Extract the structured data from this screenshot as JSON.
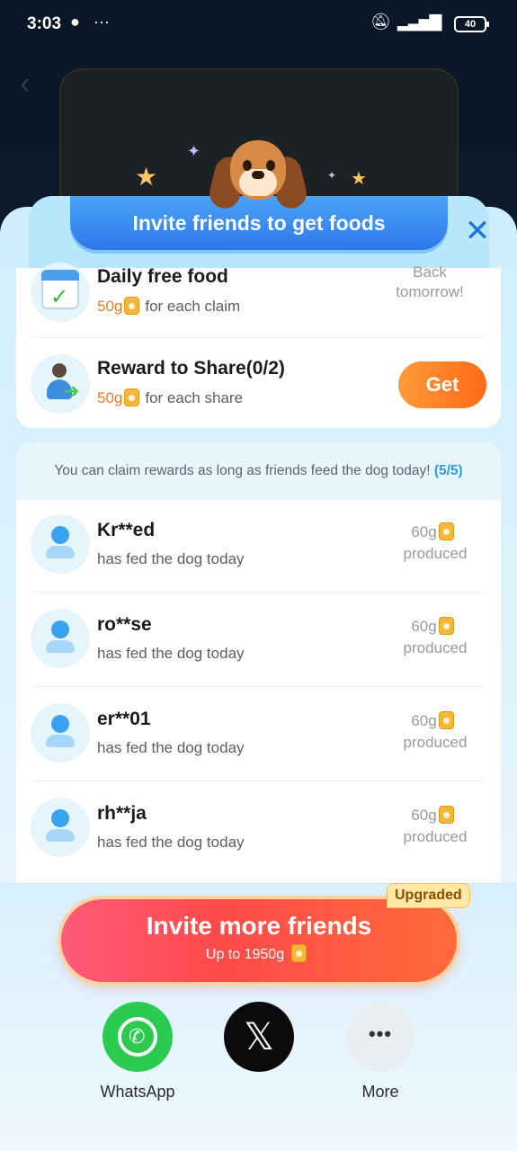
{
  "status_bar": {
    "time": "3:03",
    "battery": "40"
  },
  "sheet": {
    "title": "Invite friends to get foods",
    "close_symbol": "✕"
  },
  "tasks": [
    {
      "title": "Daily free food",
      "amount": "50g",
      "suffix": "for each claim",
      "status_line1": "Back",
      "status_line2": "tomorrow!",
      "icon": "calendar-check-icon"
    },
    {
      "title": "Reward to Share(0/2)",
      "amount": "50g",
      "suffix": "for each share",
      "button": "Get",
      "icon": "share-person-icon"
    }
  ],
  "friends": {
    "notice": "You can claim rewards as long as friends feed the dog today!",
    "notice_count": "(5/5)",
    "list": [
      {
        "name": "Kr**ed",
        "status": "has fed the dog today",
        "amount": "60g",
        "label": "produced"
      },
      {
        "name": "ro**se",
        "status": "has fed the dog today",
        "amount": "60g",
        "label": "produced"
      },
      {
        "name": "er**01",
        "status": "has fed the dog today",
        "amount": "60g",
        "label": "produced"
      },
      {
        "name": "rh**ja",
        "status": "has fed the dog today",
        "amount": "60g",
        "label": "produced"
      }
    ]
  },
  "invite": {
    "badge": "Upgraded",
    "button_label": "Invite more friends",
    "subtitle": "Up to 1950g"
  },
  "share_targets": [
    {
      "label": "WhatsApp",
      "icon": "whatsapp-icon",
      "color": "#2bcb4f"
    },
    {
      "label": "",
      "icon": "x-icon",
      "color": "#0b0b0b"
    },
    {
      "label": "More",
      "icon": "more-dots-icon",
      "color": "#e9eef3"
    }
  ]
}
